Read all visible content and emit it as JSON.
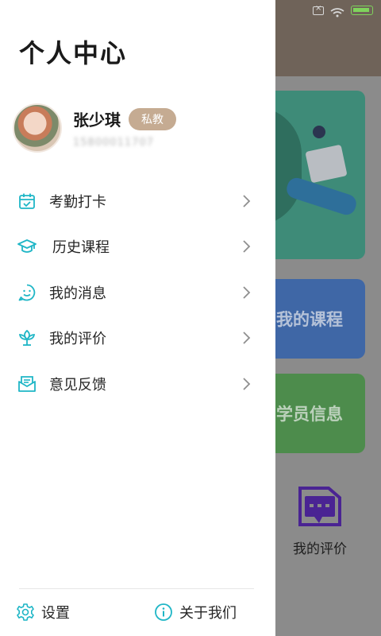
{
  "drawer": {
    "title": "个人中心",
    "profile": {
      "name": "张少琪",
      "role_badge": "私教",
      "phone": "15800011707"
    },
    "menu": [
      {
        "label": "考勤打卡",
        "icon": "calendar-check-icon"
      },
      {
        "label": "历史课程",
        "icon": "graduation-cap-icon"
      },
      {
        "label": "我的消息",
        "icon": "smile-message-icon"
      },
      {
        "label": "我的评价",
        "icon": "lotus-icon"
      },
      {
        "label": "意见反馈",
        "icon": "envelope-icon"
      }
    ],
    "footer": {
      "settings_label": "设置",
      "about_label": "关于我们"
    }
  },
  "background_app": {
    "tiles": [
      "我的课程",
      "学员信息"
    ],
    "review_label": "我的评价"
  },
  "colors": {
    "accent": "#1fb6c6",
    "badge": "#c5ab92",
    "tile_blue": "#3f67a6",
    "tile_green": "#4d8c4c",
    "review_icon": "#5a2ca0"
  }
}
